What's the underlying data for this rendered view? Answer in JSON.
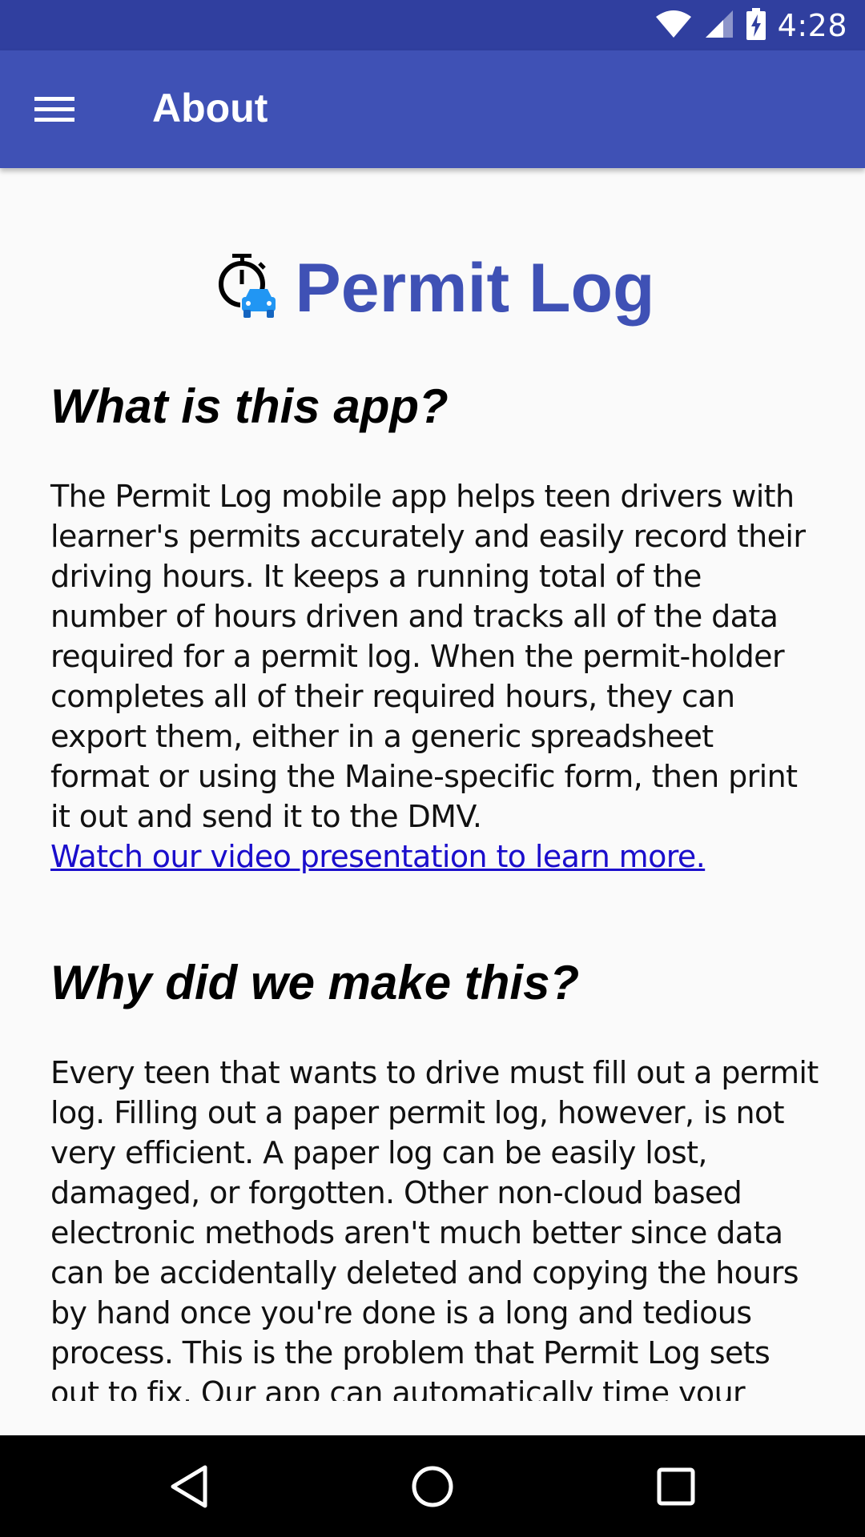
{
  "status_bar": {
    "time": "4:28",
    "icons": [
      "wifi-icon",
      "cell-signal-icon",
      "battery-charging-icon"
    ]
  },
  "app_bar": {
    "title": "About",
    "menu_icon": "hamburger-menu-icon",
    "background": "#3f51b5"
  },
  "logo": {
    "title": "Permit Log",
    "icon": "stopwatch-car-icon",
    "color": "#3f51b5"
  },
  "sections": [
    {
      "heading": "What is this app?",
      "body": "The Permit Log mobile app helps teen drivers with learner's permits accurately and easily record their driving hours. It keeps a running total of the number of hours driven and tracks all of the data required for a permit log. When the permit-holder completes all of their required hours, they can export them, either in a generic spreadsheet format or using the Maine-specific form, then print it out and send it to the DMV.",
      "link": "Watch our video presentation to learn more."
    },
    {
      "heading": "Why did we make this?",
      "body": "Every teen that wants to drive must fill out a permit log. Filling out a paper permit log, however, is not very efficient. A paper log can be easily lost, damaged, or forgotten. Other non-cloud based electronic methods aren't much better since data can be accidentally deleted and copying the hours by hand once you're done is a long and tedious process. This is the problem that Permit Log sets out to fix. Our app can automatically time your"
    }
  ],
  "nav_bar": {
    "buttons": [
      "back-icon",
      "home-icon",
      "recents-icon"
    ]
  }
}
